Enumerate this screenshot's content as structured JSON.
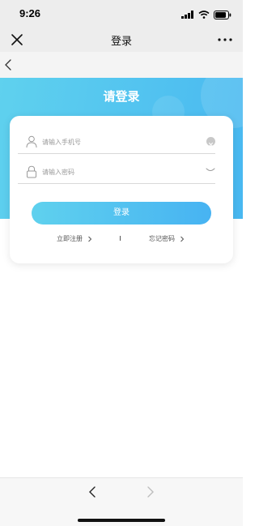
{
  "status_bar": {
    "time": "9:26",
    "icons": [
      "signal-icon",
      "wifi-icon",
      "battery-icon"
    ]
  },
  "nav": {
    "title": "登录",
    "close_icon": "close-icon",
    "more_icon": "more-icon"
  },
  "back_icon": "chevron-left-icon",
  "hero": {
    "title": "请登录"
  },
  "form": {
    "phone_placeholder": "请输入手机号",
    "phone_value": "",
    "password_placeholder": "请输入密码",
    "password_value": "",
    "login_label": "登录"
  },
  "links": {
    "register": "立即注册",
    "forgot": "忘记密码"
  },
  "colors": {
    "accent_start": "#5fd1ee",
    "accent_end": "#47b3f2",
    "nav_bg": "#ededed"
  },
  "bottom_bar": {
    "back_icon": "chevron-left-icon",
    "forward_icon": "chevron-right-icon"
  }
}
